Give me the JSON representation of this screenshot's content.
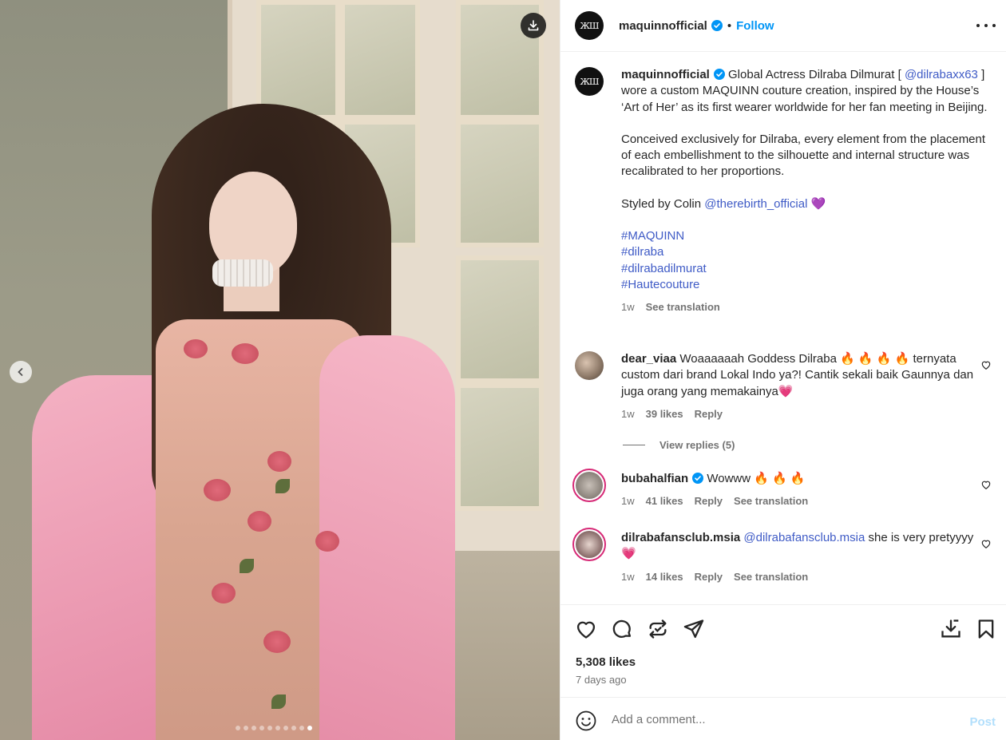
{
  "media": {
    "download_icon": "download-icon",
    "prev_icon": "chevron-left-icon",
    "carousel_count": 10,
    "carousel_active_index": 9
  },
  "header": {
    "username": "maquinnofficial",
    "separator": "•",
    "follow_label": "Follow",
    "logo_text": "ЖШ"
  },
  "caption": {
    "username": "maquinnofficial",
    "text_1a": "Global Actress Dilraba Dilmurat [",
    "mention": "@dilrabaxx63",
    "text_1b": "] wore a custom MAQUINN couture creation, inspired by the House’s ‘Art of Her’ as its first wearer worldwide for her fan meeting in Beijing.",
    "text_2": "Conceived exclusively for Dilraba, every element from the placement of each embellishment to the silhouette and internal structure was recalibrated to her proportions.",
    "styled_prefix": "Styled by Colin",
    "styled_mention": "@therebirth_official",
    "styled_emoji": "💜",
    "hashtags": [
      "#MAQUINN",
      "#dilraba",
      "#dilrabadilmurat",
      "#Hautecouture"
    ],
    "time": "1w",
    "see_translation": "See translation"
  },
  "comments": [
    {
      "username": "dear_viaa",
      "text": "Woaaaaaah Goddess Dilraba 🔥 🔥 🔥 🔥  ternyata custom dari brand Lokal Indo ya?! Cantik sekali baik Gaunnya dan juga orang yang memakainya💗",
      "time": "1w",
      "likes": "39 likes",
      "reply": "Reply",
      "view_replies": "View replies (5)"
    },
    {
      "username": "bubahalfian",
      "text": "Wowww 🔥 🔥 🔥",
      "time": "1w",
      "likes": "41 likes",
      "reply": "Reply",
      "see_translation": "See translation"
    },
    {
      "username": "dilrabafansclub.msia",
      "mention": "@dilrabafansclub.msia",
      "text": "she is very pretyyyy 💗",
      "time": "1w",
      "likes": "14 likes",
      "reply": "Reply",
      "see_translation": "See translation"
    }
  ],
  "post": {
    "likes": "5,308 likes",
    "date": "7 days ago"
  },
  "add_comment": {
    "placeholder": "Add a comment...",
    "post_label": "Post"
  },
  "colors": {
    "accent": "#0095f6",
    "link": "#3f5bc6",
    "muted": "#737373",
    "post_disabled": "#b2dffc"
  }
}
